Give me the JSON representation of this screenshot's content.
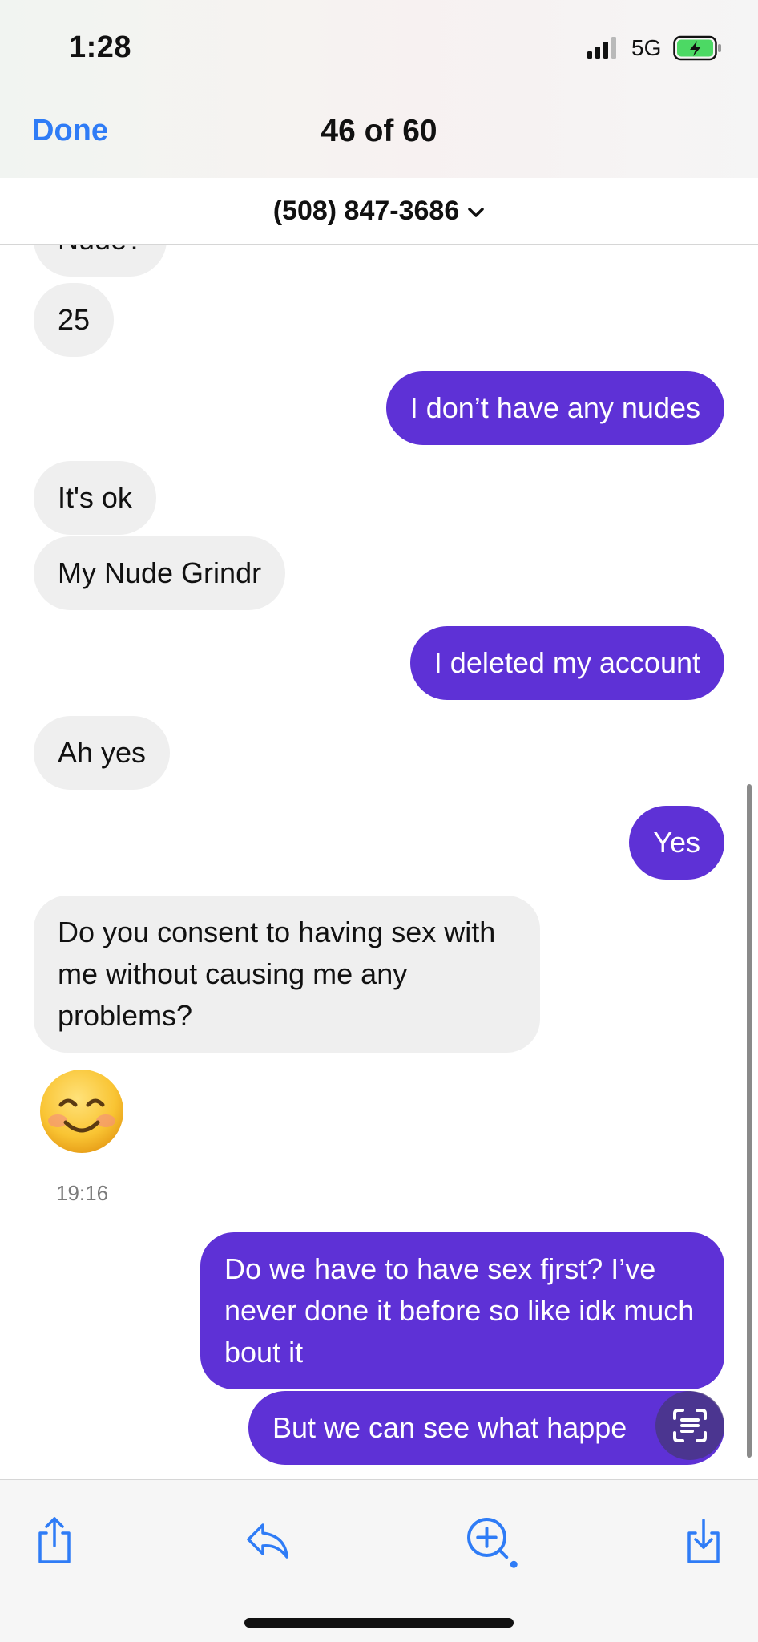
{
  "status_bar": {
    "time": "1:28",
    "network": "5G"
  },
  "nav": {
    "done_label": "Done",
    "counter": "46 of 60"
  },
  "contact": {
    "number": "(508) 847-3686"
  },
  "messages": [
    {
      "side": "in",
      "text": "Nude?"
    },
    {
      "side": "in",
      "text": "25"
    },
    {
      "side": "out",
      "text": "I don’t have any nudes"
    },
    {
      "side": "in",
      "text": "It's ok"
    },
    {
      "side": "in",
      "text": "My Nude Grindr"
    },
    {
      "side": "out",
      "text": "I deleted my account"
    },
    {
      "side": "in",
      "text": "Ah yes"
    },
    {
      "side": "out",
      "text": "Yes"
    },
    {
      "side": "in",
      "text": "Do you consent to having sex with me without causing me any problems?"
    },
    {
      "side": "in",
      "text": "",
      "icon": "smiling-face-emoji"
    },
    {
      "side": "out",
      "text": "Do we have to have sex fjrst? I’ve never done it before so like idk much bout it"
    },
    {
      "side": "out",
      "text": "But we can see what happe"
    }
  ],
  "timestamp": "19:16",
  "toolbar": {
    "items": [
      "share-icon",
      "reply-icon",
      "zoom-icon",
      "download-icon"
    ]
  },
  "colors": {
    "accent": "#2f7cf6",
    "outgoing_bubble": "#5e31d6",
    "incoming_bubble": "#efefef",
    "battery": "#4cd964"
  }
}
